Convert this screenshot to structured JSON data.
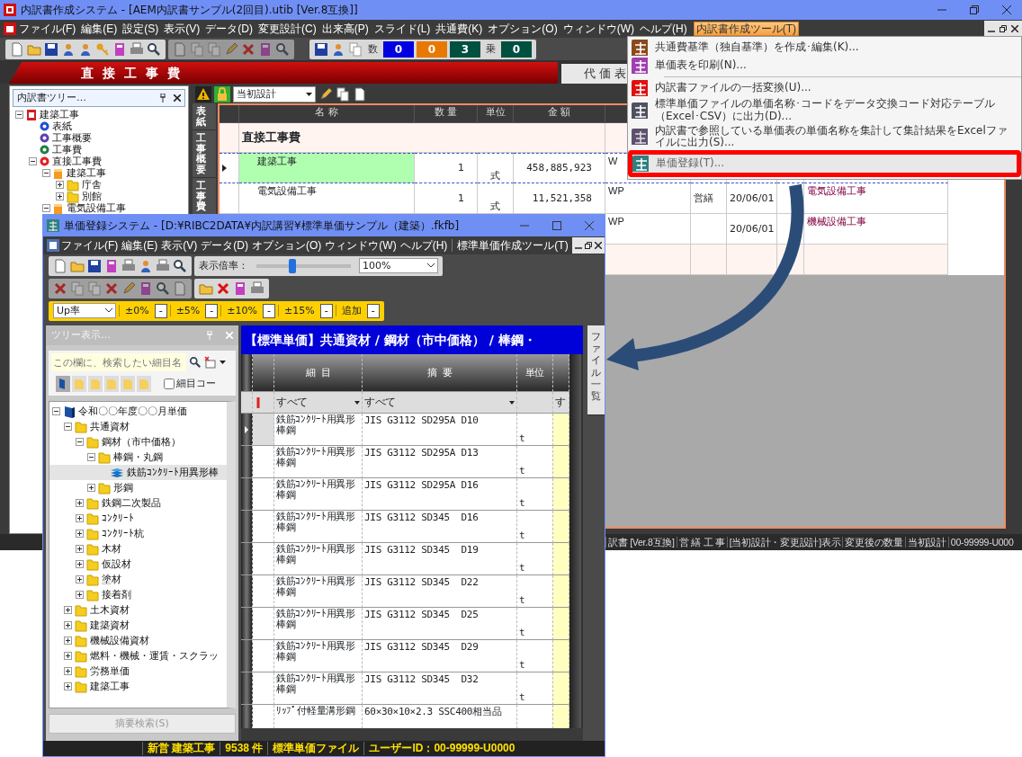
{
  "main_window": {
    "title": "内訳書作成システム - [AEM内訳書サンプル(2回目).utib [Ver.8互換]]",
    "menu": [
      {
        "label": "ファイル(F)",
        "selected": false
      },
      {
        "label": "編集(E)",
        "selected": false
      },
      {
        "label": "設定(S)",
        "selected": false
      },
      {
        "label": "表示(V)",
        "selected": false
      },
      {
        "label": "データ(D)",
        "selected": false
      },
      {
        "label": "変更設計(C)",
        "selected": false
      },
      {
        "label": "出来高(P)",
        "selected": false
      },
      {
        "label": "スライド(L)",
        "selected": false
      },
      {
        "label": "共通費(K)",
        "selected": false
      },
      {
        "label": "オプション(O)",
        "selected": false
      },
      {
        "label": "ウィンドウ(W)",
        "selected": false
      },
      {
        "label": "ヘルプ(H)",
        "selected": false
      },
      {
        "label": "内訳書作成ツール(T)",
        "selected": true
      }
    ],
    "counters": [
      {
        "label": "数",
        "values": [
          {
            "text": "0",
            "color": "#0000e0"
          },
          {
            "text": "0",
            "color": "#e87800"
          },
          {
            "text": "3",
            "color": "#005040"
          }
        ]
      },
      {
        "label": "乗",
        "values": [
          {
            "text": "0",
            "color": "#005040"
          }
        ]
      }
    ],
    "tabs": [
      {
        "label": "直接工事費",
        "selected": true
      },
      {
        "label": "代価表",
        "selected": false
      }
    ],
    "tree": {
      "title": "内訳書ツリー…",
      "items": [
        {
          "label": "建築工事",
          "kind": "doc",
          "selected": false,
          "expanded": true,
          "children": [
            {
              "label": "表紙",
              "kind": "dot",
              "color": "#2050d0",
              "selected": false
            },
            {
              "label": "工事概要",
              "kind": "dot",
              "color": "#6040b0",
              "selected": false
            },
            {
              "label": "工事費",
              "kind": "dot",
              "color": "#208040",
              "selected": false
            },
            {
              "label": "直接工事費",
              "kind": "dot",
              "color": "#e02020",
              "selected": false,
              "expanded": true,
              "children": [
                {
                  "label": "建築工事",
                  "kind": "section",
                  "selected": false,
                  "expanded": true,
                  "children": [
                    {
                      "label": "庁舎",
                      "kind": "folder",
                      "selected": false,
                      "expanded": false
                    },
                    {
                      "label": "別館",
                      "kind": "folder",
                      "selected": false,
                      "expanded": false
                    }
                  ]
                },
                {
                  "label": "電気設備工事",
                  "kind": "section",
                  "selected": false,
                  "expanded": true
                }
              ]
            }
          ]
        }
      ]
    },
    "design_select": "当初設計",
    "side_tabs": [
      {
        "label": "表紙"
      },
      {
        "label": "工事概要"
      },
      {
        "label": "工事費"
      }
    ],
    "grid": {
      "columns": [
        "名 称",
        "数 量",
        "単位",
        "金 額"
      ],
      "section": "直接工事費",
      "rows": [
        {
          "name": "建築工事",
          "quantity": "1",
          "unit": "式",
          "amount": "458,885,923",
          "code": "W",
          "selected": true
        },
        {
          "name": "電気設備工事",
          "quantity": "1",
          "unit": "式",
          "amount": "11,521,358",
          "code": "WP",
          "category": "営繕",
          "date": "20/06/01",
          "remark": "電気設備工事",
          "selected": false
        },
        {
          "code": "WP",
          "date": "20/06/01",
          "remark": "機械設備工事",
          "selected": false
        }
      ]
    },
    "status_bar": [
      "訳書 [Ver.8互換]",
      "営 繕 工 事",
      "[当初設計・変更設計]表示",
      "変更後の数量",
      "当初設計",
      "00-99999-U000"
    ]
  },
  "tool_menu": {
    "items": [
      {
        "label": "共通費基準（独自基準）を作成･編集(K)...",
        "kind": "shared",
        "separator_before": false,
        "highlighted": false
      },
      {
        "label": "単価表を印刷(N)...",
        "kind": "print",
        "separator_before": false,
        "highlighted": false
      },
      {
        "label": "内訳書ファイルの一括変換(U)...",
        "kind": "convert",
        "separator_before": true,
        "highlighted": false
      },
      {
        "label": "標準単価ファイルの単価名称･コードをデータ交換コード対応テーブル（Excel･CSV）に出力(D)...",
        "kind": "table",
        "separator_before": false,
        "highlighted": false
      },
      {
        "label": "内訳書で参照している単価表の単価名称を集計して集計結果をExcelファイルに出力(S)...",
        "kind": "aggregate",
        "separator_before": false,
        "highlighted": false
      },
      {
        "label": "単価登録(T)...",
        "kind": "register",
        "separator_before": false,
        "highlighted": true
      }
    ]
  },
  "unit_window": {
    "title": "単価登録システム - [D:¥RIBC2DATA¥内訳講習¥標準単価サンプル（建築）.fkfb]",
    "menu": [
      {
        "label": "ファイル(F)"
      },
      {
        "label": "編集(E)"
      },
      {
        "label": "表示(V)"
      },
      {
        "label": "データ(D)"
      },
      {
        "label": "オプション(O)"
      },
      {
        "label": "ウィンドウ(W)"
      },
      {
        "label": "ヘルプ(H)"
      }
    ],
    "tool_menu": "標準単価作成ツール(T)",
    "zoom_label": "表示倍率：",
    "zoom_slider": {
      "level": 0.38
    },
    "zoom_select": "100%",
    "rate_select": "Up率",
    "rate_buttons": [
      {
        "label": "±0%",
        "button": "-"
      },
      {
        "label": "±5%",
        "button": "-"
      },
      {
        "label": "±10%",
        "button": "-"
      },
      {
        "label": "±15%",
        "button": "-"
      },
      {
        "label": "追加",
        "button": "-"
      }
    ],
    "side_tab": "ファイル一覧",
    "tree_panel": {
      "title": "ツリー表示…",
      "search_placeholder": "この欄に、検索したい細目名",
      "checkbox": {
        "label": "細目コー",
        "checked": false
      },
      "items": [
        {
          "label": "令和〇〇年度〇〇月単価",
          "kind": "book",
          "selected": false,
          "expanded": true,
          "children": [
            {
              "label": "共通資材",
              "kind": "folder",
              "selected": false,
              "expanded": true,
              "children": [
                {
                  "label": "鋼材（市中価格）",
                  "kind": "folder",
                  "selected": false,
                  "expanded": true,
                  "children": [
                    {
                      "label": "棒鋼・丸鋼",
                      "kind": "folder",
                      "selected": false,
                      "expanded": true,
                      "children": [
                        {
                          "label": "鉄筋ｺﾝｸﾘｰﾄ用異形棒",
                          "kind": "steel",
                          "selected": true
                        }
                      ]
                    },
                    {
                      "label": "形鋼",
                      "kind": "folder",
                      "selected": false,
                      "expanded": false
                    }
                  ]
                },
                {
                  "label": "鉄鋼二次製品",
                  "kind": "folder",
                  "selected": false,
                  "expanded": false
                },
                {
                  "label": "ｺﾝｸﾘｰﾄ",
                  "kind": "folder",
                  "selected": false,
                  "expanded": false
                },
                {
                  "label": "ｺﾝｸﾘｰﾄ杭",
                  "kind": "folder",
                  "selected": false,
                  "expanded": false
                },
                {
                  "label": "木材",
                  "kind": "folder",
                  "selected": false,
                  "expanded": false
                },
                {
                  "label": "仮設材",
                  "kind": "folder",
                  "selected": false,
                  "expanded": false
                },
                {
                  "label": "塗材",
                  "kind": "folder",
                  "selected": false,
                  "expanded": false
                },
                {
                  "label": "接着剤",
                  "kind": "folder",
                  "selected": false,
                  "expanded": false
                }
              ]
            },
            {
              "label": "土木資材",
              "kind": "folder",
              "selected": false,
              "expanded": false
            },
            {
              "label": "建築資材",
              "kind": "folder",
              "selected": false,
              "expanded": false
            },
            {
              "label": "機械設備資材",
              "kind": "folder",
              "selected": false,
              "expanded": false
            },
            {
              "label": "燃料・機械・運賃・スクラッ",
              "kind": "folder",
              "selected": false,
              "expanded": false
            },
            {
              "label": "労務単価",
              "kind": "folder",
              "selected": false,
              "expanded": false
            },
            {
              "label": "建築工事",
              "kind": "folder",
              "selected": false,
              "expanded": false
            }
          ]
        }
      ],
      "search_button": {
        "label": "摘要検索(S)",
        "disabled": true
      }
    },
    "grid": {
      "breadcrumb": "【標準単価】共通資材 / 鋼材（市中価格） / 棒鋼・",
      "columns": [
        "細 目",
        "摘 要",
        "単位"
      ],
      "filters": [
        {
          "kind": "dropdown",
          "text": "すべて"
        },
        {
          "kind": "dropdown",
          "text": "すべて"
        },
        {
          "kind": "blank"
        },
        {
          "kind": "plain",
          "text": "す"
        }
      ],
      "rows": [
        {
          "name": "鉄筋ｺﾝｸﾘｰﾄ用異形棒鋼",
          "spec": "JIS G3112 SD295A D10",
          "unit": "t",
          "selected": true
        },
        {
          "name": "鉄筋ｺﾝｸﾘｰﾄ用異形棒鋼",
          "spec": "JIS G3112 SD295A D13",
          "unit": "t",
          "selected": false
        },
        {
          "name": "鉄筋ｺﾝｸﾘｰﾄ用異形棒鋼",
          "spec": "JIS G3112 SD295A D16",
          "unit": "t",
          "selected": false
        },
        {
          "name": "鉄筋ｺﾝｸﾘｰﾄ用異形棒鋼",
          "spec": "JIS G3112 SD345  D16",
          "unit": "t",
          "selected": false
        },
        {
          "name": "鉄筋ｺﾝｸﾘｰﾄ用異形棒鋼",
          "spec": "JIS G3112 SD345  D19",
          "unit": "t",
          "selected": false
        },
        {
          "name": "鉄筋ｺﾝｸﾘｰﾄ用異形棒鋼",
          "spec": "JIS G3112 SD345  D22",
          "unit": "t",
          "selected": false
        },
        {
          "name": "鉄筋ｺﾝｸﾘｰﾄ用異形棒鋼",
          "spec": "JIS G3112 SD345  D25",
          "unit": "t",
          "selected": false
        },
        {
          "name": "鉄筋ｺﾝｸﾘｰﾄ用異形棒鋼",
          "spec": "JIS G3112 SD345  D29",
          "unit": "t",
          "selected": false
        },
        {
          "name": "鉄筋ｺﾝｸﾘｰﾄ用異形棒鋼",
          "spec": "JIS G3112 SD345  D32",
          "unit": "t",
          "selected": false
        },
        {
          "name": "ﾘｯﾌﾟ付軽量溝形鋼",
          "spec": "60×30×10×2.3 SSC400相当品",
          "selected": false
        }
      ]
    },
    "status_bar": [
      "新営 建築工事",
      "9538 件",
      "標準単価ファイル",
      "ユーザーID：00-99999-U0000"
    ]
  }
}
